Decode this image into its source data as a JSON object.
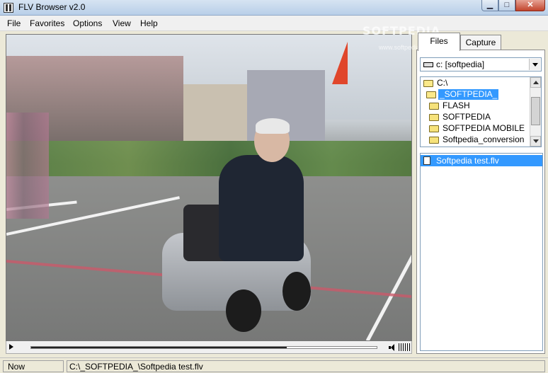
{
  "window": {
    "title": "FLV Browser v2.0"
  },
  "menu": {
    "file": "File",
    "favorites": "Favorites",
    "options": "Options",
    "view": "View",
    "help": "Help"
  },
  "watermark": {
    "brand": "SOFTPEDIA",
    "url": "www.softpedia.com"
  },
  "player": {
    "seek_progress_percent": 74
  },
  "tabs": {
    "files": "Files",
    "capture": "Capture"
  },
  "drive": {
    "selected": "c: [softpedia]"
  },
  "folders": [
    {
      "label": "C:\\",
      "state": "open",
      "indent": 0
    },
    {
      "label": "_SOFTPEDIA_",
      "state": "open-selected",
      "indent": 1
    },
    {
      "label": "FLASH",
      "state": "closed",
      "indent": 2
    },
    {
      "label": "SOFTPEDIA",
      "state": "closed",
      "indent": 2
    },
    {
      "label": "SOFTPEDIA MOBILE",
      "state": "closed",
      "indent": 2
    },
    {
      "label": "Softpedia_conversion",
      "state": "closed",
      "indent": 2
    }
  ],
  "files": [
    {
      "label": "Softpedia test.flv",
      "selected": true
    }
  ],
  "status": {
    "label": "Now Playing..",
    "path": "C:\\_SOFTPEDIA_\\Softpedia test.flv"
  },
  "colors": {
    "selection": "#3399ff",
    "close_button": "#c2452d"
  }
}
